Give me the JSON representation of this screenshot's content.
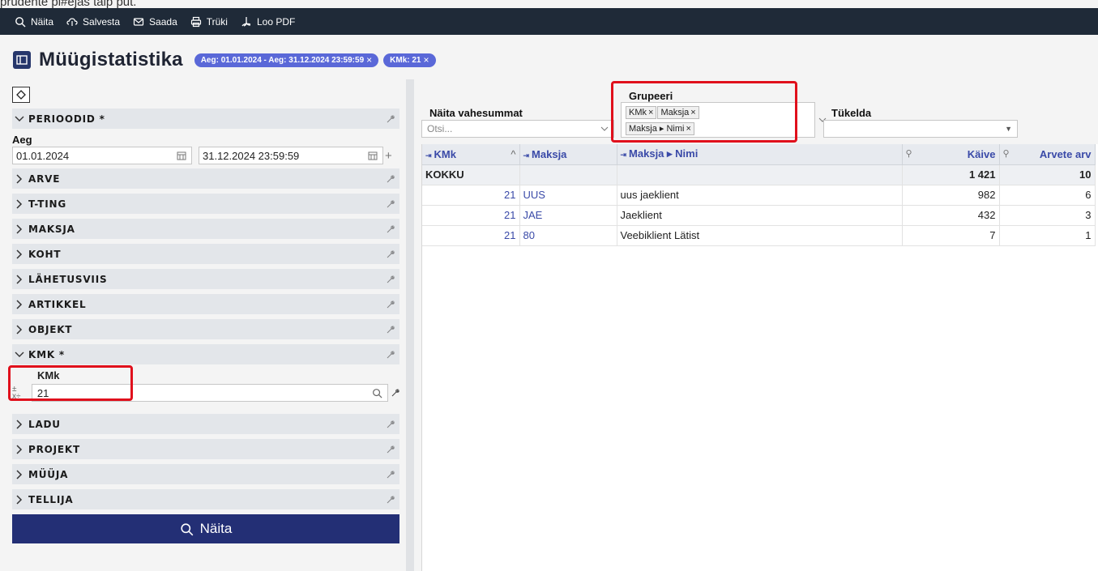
{
  "caption": "prudente pi#ejas taip put.",
  "toolbar": {
    "items": [
      {
        "label": "Näita",
        "icon": "search-icon"
      },
      {
        "label": "Salvesta",
        "icon": "cloud-icon"
      },
      {
        "label": "Saada",
        "icon": "mail-icon"
      },
      {
        "label": "Trüki",
        "icon": "printer-icon"
      },
      {
        "label": "Loo PDF",
        "icon": "pdf-icon"
      }
    ]
  },
  "header": {
    "title": "Müügistatistika",
    "chips": [
      "Aeg: 01.01.2024 - Aeg: 31.12.2024 23:59:59",
      "KMk: 21"
    ]
  },
  "filters": {
    "periods_label": "PERIOODID *",
    "aeg_label": "Aeg",
    "date_from": "01.01.2024",
    "date_to": "31.12.2024 23:59:59",
    "sections": [
      "ARVE",
      "T-TING",
      "MAKSJA",
      "KOHT",
      "LÄHETUSVIIS",
      "ARTIKKEL",
      "OBJEKT"
    ],
    "kmk_section": "KMK *",
    "kmk_label": "KMk",
    "kmk_value": "21",
    "sections_after": [
      "LADU",
      "PROJEKT",
      "MÜÜJA",
      "TELLIJA"
    ],
    "submit_label": "Näita"
  },
  "controls": {
    "subtotals_label": "Näita vahesummat",
    "subtotals_placeholder": "Otsi...",
    "group_label": "Grupeeri",
    "group_chips": [
      "KMk",
      "Maksja",
      "Maksja ▸ Nimi"
    ],
    "split_label": "Tükelda"
  },
  "table": {
    "columns": [
      "KMk",
      "Maksja",
      "Maksja ▸ Nimi",
      "Käive",
      "Arvete arv"
    ],
    "total": {
      "label": "KOKKU",
      "kaive": "1 421",
      "arvete_arv": "10"
    },
    "rows": [
      {
        "kmk": "21",
        "maksja": "UUS",
        "nimi": "uus jaeklient",
        "kaive": "982",
        "arvete_arv": "6"
      },
      {
        "kmk": "21",
        "maksja": "JAE",
        "nimi": "Jaeklient",
        "kaive": "432",
        "arvete_arv": "3"
      },
      {
        "kmk": "21",
        "maksja": "80",
        "nimi": "Veebiklient Lätist",
        "kaive": "7",
        "arvete_arv": "1"
      }
    ]
  },
  "colors": {
    "toolbar_bg": "#1f2a38",
    "chip": "#5a68d8",
    "primary": "#232f75",
    "highlight": "#e0101c",
    "link": "#3a4aa8"
  }
}
